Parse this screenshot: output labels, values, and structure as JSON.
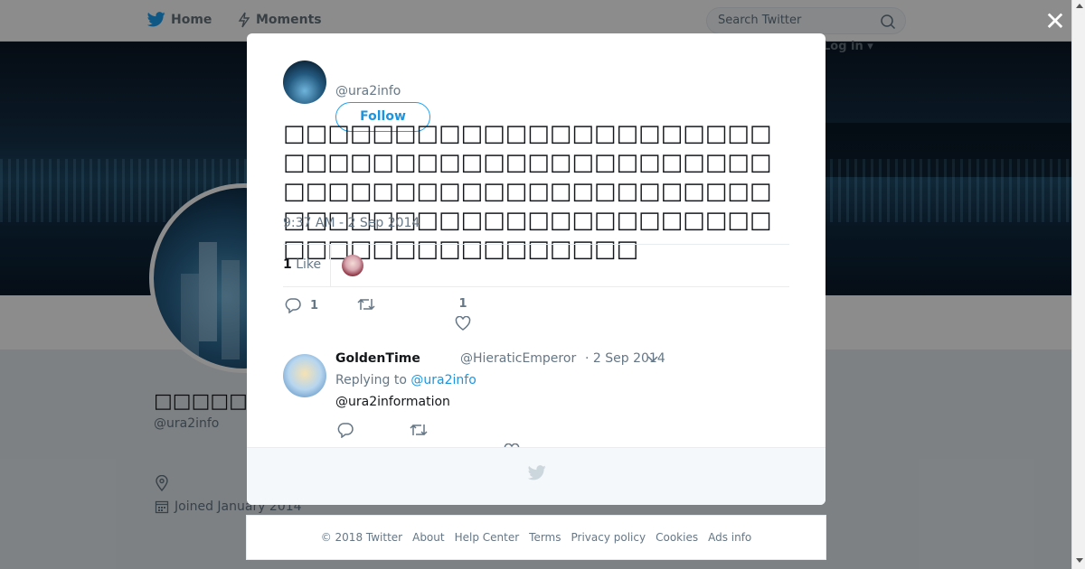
{
  "nav": {
    "home_label": "Home",
    "moments_label": "Moments",
    "search_placeholder": "Search Twitter",
    "login_label": "Log in"
  },
  "profile": {
    "name": "□□□□□□□□□□□",
    "handle": "@ura2info",
    "joined": "Joined January 2014"
  },
  "tweet": {
    "handle": "@ura2info",
    "follow_label": "Follow",
    "text": "□□□□□□□□□□□□□□□□□□□□□□□□□□□□□□□□□□□□□□□□□□□□□□□□□□□□□□□□□□□□□□□□□□□□□□□□□□□□□□□□□□□□□□□□□□□□□□□□□□□□□□□□",
    "time": "9:37 AM - 2 Sep 2014",
    "like_count": "1",
    "like_label": "Like",
    "reply_count": "1",
    "action_like_count": "1"
  },
  "reply": {
    "name": "GoldenTime",
    "handle": "@HieraticEmperor",
    "date": "· 2 Sep 2014",
    "replying_prefix": "Replying to",
    "replying_to": "@ura2info",
    "text": "@ura2information"
  },
  "footer": {
    "items": [
      "© 2018 Twitter",
      "About",
      "Help Center",
      "Terms",
      "Privacy policy",
      "Cookies",
      "Ads info"
    ]
  },
  "colors": {
    "accent": "#1da1f2",
    "link": "#1b95e0",
    "secondary_text": "#657786"
  }
}
